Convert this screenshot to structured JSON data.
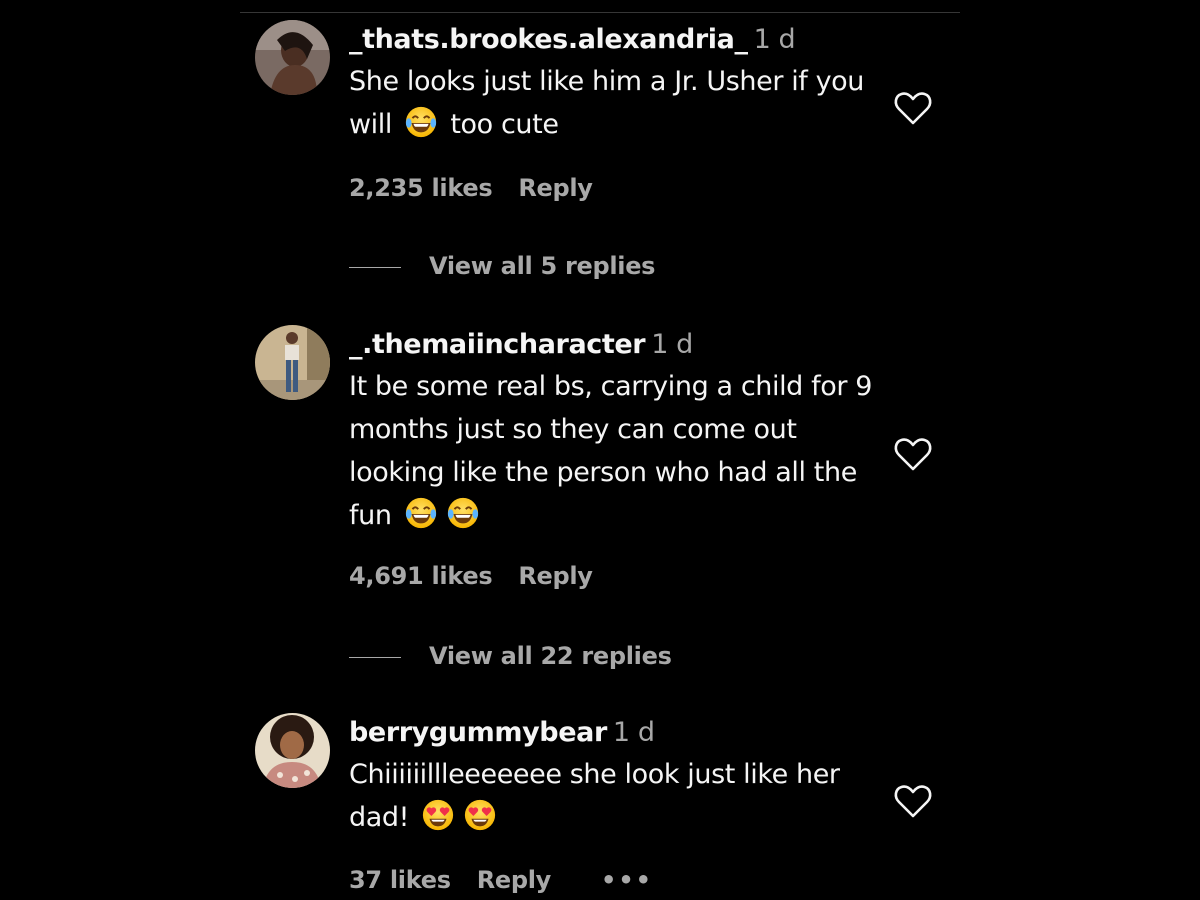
{
  "comments": [
    {
      "username": "_thats.brookes.alexandria_",
      "time": "1 d",
      "text_part1": "She looks just like him a Jr. Usher if you will",
      "emoji1": "laughing-tears-emoji",
      "text_part2": "too cute",
      "likes": "2,235 likes",
      "reply_label": "Reply",
      "view_replies": "View all 5 replies"
    },
    {
      "username": "_.themaiincharacter",
      "time": "1 d",
      "text": "It be some real bs, carrying a child for 9 months just so they can come out looking like the person who had all the fun",
      "emoji1": "laughing-tears-emoji",
      "emoji2": "laughing-tears-emoji",
      "likes": "4,691 likes",
      "reply_label": "Reply",
      "view_replies": "View all 22 replies"
    },
    {
      "username": "berrygummybear",
      "time": "1 d",
      "text": "Chiiiiiillleeeeeee she look just like her dad!",
      "emoji1": "heart-eyes-emoji",
      "emoji2": "heart-eyes-emoji",
      "likes": "37 likes",
      "reply_label": "Reply",
      "more": "•••"
    }
  ],
  "icons": {
    "like": "heart-outline-icon"
  },
  "colors": {
    "background": "#000000",
    "text_primary": "#f5f5f5",
    "text_secondary": "#a8a8a8",
    "divider": "#363636"
  }
}
